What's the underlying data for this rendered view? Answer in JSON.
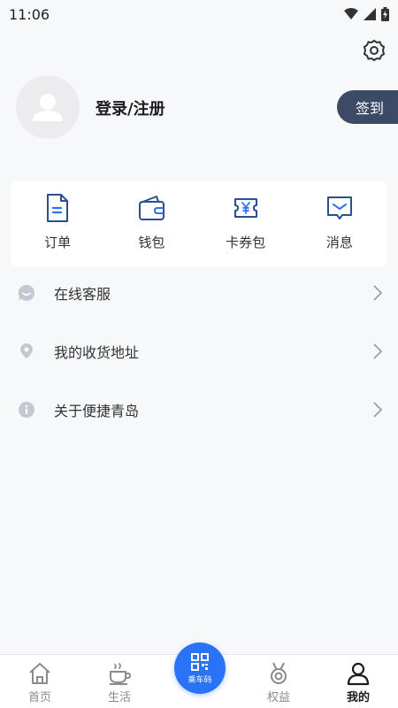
{
  "status_bar": {
    "time": "11:06"
  },
  "profile": {
    "login_text": "登录/注册",
    "checkin_label": "签到"
  },
  "quick_actions": [
    {
      "label": "订单",
      "icon": "order-document-icon"
    },
    {
      "label": "钱包",
      "icon": "wallet-icon"
    },
    {
      "label": "卡券包",
      "icon": "coupon-icon"
    },
    {
      "label": "消息",
      "icon": "message-icon"
    }
  ],
  "menu": [
    {
      "label": "在线客服",
      "icon": "chat-bubble-icon"
    },
    {
      "label": "我的收货地址",
      "icon": "location-pin-icon"
    },
    {
      "label": "关于便捷青岛",
      "icon": "info-icon"
    }
  ],
  "tabbar": {
    "home": "首页",
    "life": "生活",
    "ride_code": "乘车码",
    "benefits": "权益",
    "mine": "我的"
  },
  "colors": {
    "accent": "#2a72f6",
    "checkin_bg": "#3c4a66",
    "icon_blue": "#2c4f8f"
  }
}
